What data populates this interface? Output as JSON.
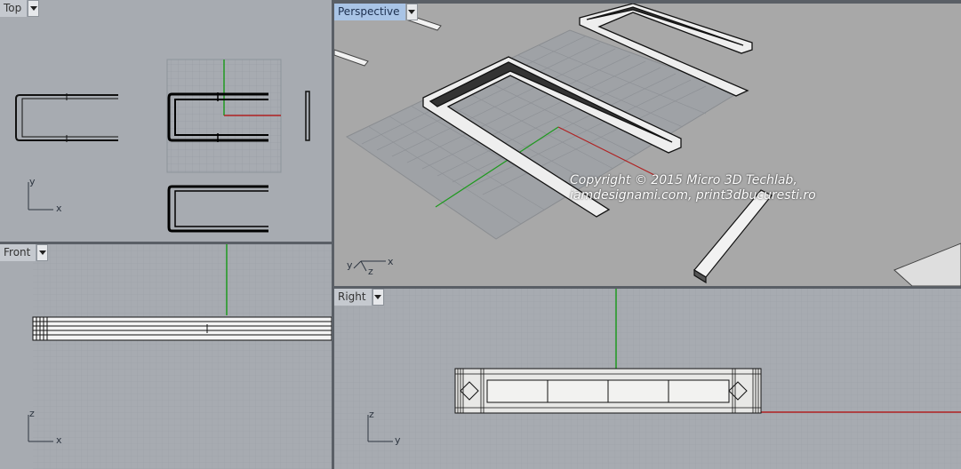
{
  "viewports": {
    "top": {
      "label": "Top",
      "axis_h": "x",
      "axis_v": "y"
    },
    "perspective": {
      "label": "Perspective",
      "axis_h": "x",
      "axis_v": "y",
      "axis_z": "z"
    },
    "front": {
      "label": "Front",
      "axis_h": "x",
      "axis_v": "z"
    },
    "right": {
      "label": "Right",
      "axis_h": "y",
      "axis_v": "z"
    }
  },
  "watermark": {
    "line1": "Copyright © 2015 Micro 3D Techlab,",
    "line2": "iamdesignami.com, print3dbucuresti.ro"
  },
  "colors": {
    "viewport_bg": "#a7abb1",
    "perspective_bg": "#a8a8a8",
    "grid": "#959aa1",
    "x_axis": "#b02020",
    "y_axis": "#1f9a1f",
    "active_tab": "#a9c4e6"
  },
  "icons": {
    "dropdown": "chevron-down-icon"
  }
}
